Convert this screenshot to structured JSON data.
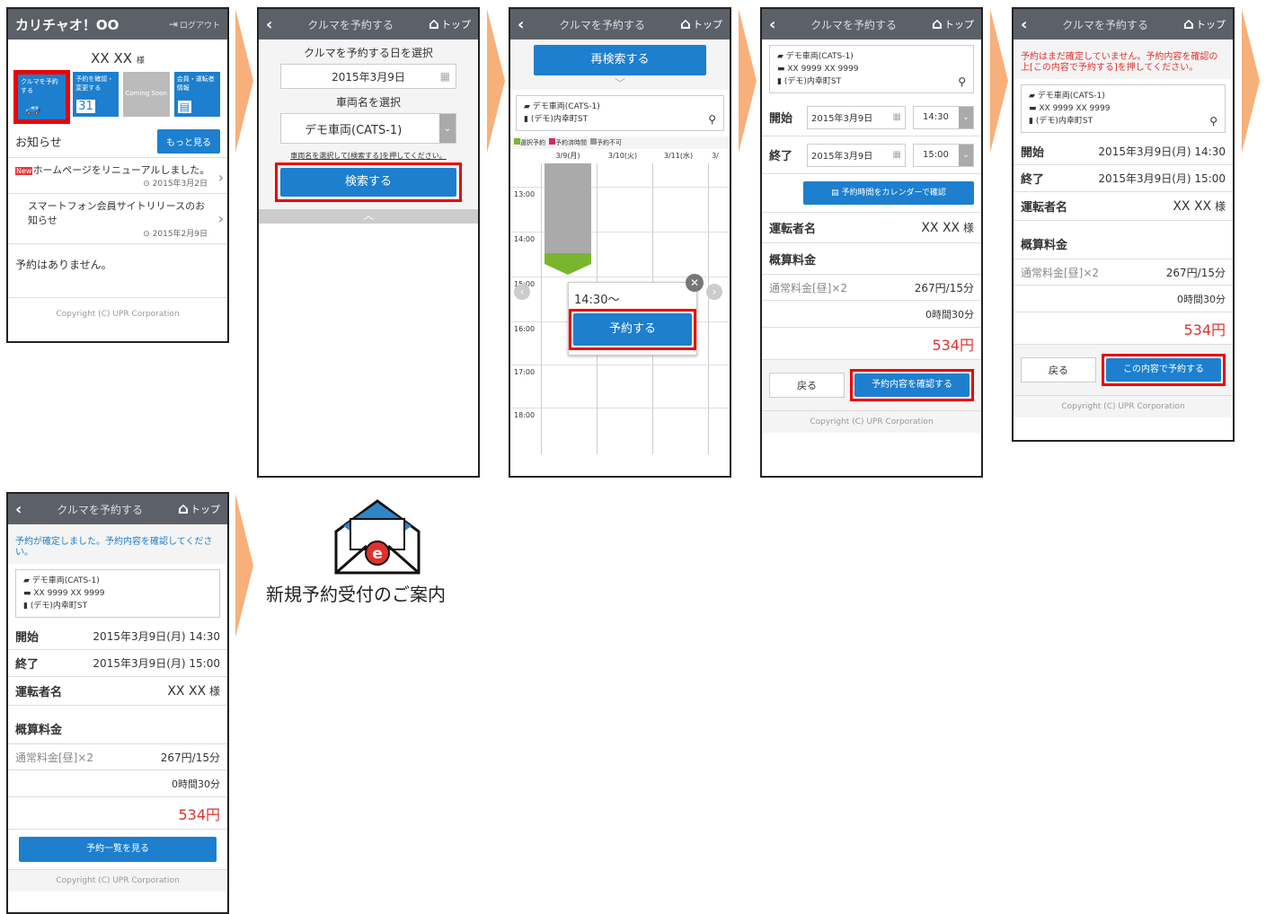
{
  "common": {
    "title": "クルマを予約する",
    "home": "トップ",
    "copyright": "Copyright (C) UPR Corporation",
    "vehicle": "デモ車両(CATS-1)",
    "plate": "XX 9999 XX 9999",
    "station": "(デモ)内幸町ST",
    "start_label": "開始",
    "end_label": "終了",
    "start_value": "2015年3月9日(月) 14:30",
    "end_value": "2015年3月9日(月) 15:00",
    "driver_label": "運転者名",
    "driver_name": "XX XX",
    "sama": "様",
    "fee_label": "概算料金",
    "fee_item": "通常料金[昼]×2",
    "fee_rate": "267円/15分",
    "fee_duration": "0時間30分",
    "fee_total": "534円",
    "back_btn": "戻る"
  },
  "screen1": {
    "app_title": "カリチャオ！OO",
    "logout": "ログアウト",
    "user": "XX XX",
    "sama": "様",
    "tiles": [
      {
        "label": "クルマを予約する",
        "icon": "car-icon"
      },
      {
        "label": "予約を確認・変更する",
        "icon": "calendar-icon"
      },
      {
        "label": "Coming Soon",
        "icon": "blank-icon"
      },
      {
        "label": "会員・運転者情報",
        "icon": "id-card-icon"
      }
    ],
    "news_label": "お知らせ",
    "more_btn": "もっと見る",
    "new_badge": "New",
    "news": [
      {
        "text": "ホームページをリニューアルしました。",
        "date": "2015年3月2日"
      },
      {
        "text": "スマートフォン会員サイトリリースのお知らせ",
        "date": "2015年2月9日"
      }
    ],
    "no_reservation": "予約はありません。"
  },
  "screen2": {
    "date_label": "クルマを予約する日を選択",
    "date_value": "2015年3月9日",
    "car_label": "車両名を選択",
    "car_value": "デモ車両(CATS-1)",
    "hint": "車両名を選択して[検索する]を押してください。",
    "search_btn": "検索する"
  },
  "screen3": {
    "research_btn": "再検索する",
    "legend": [
      "選択予約",
      "予約済時間",
      "予約不可"
    ],
    "days": [
      "3/9(月)",
      "3/10(火)",
      "3/11(水)",
      "3/"
    ],
    "hours": [
      "13:00",
      "14:00",
      "15:00",
      "16:00",
      "17:00",
      "18:00"
    ],
    "popup_time": "14:30〜",
    "reserve_btn": "予約する"
  },
  "screen4": {
    "start_date": "2015年3月9日",
    "start_time": "14:30",
    "end_date": "2015年3月9日",
    "end_time": "15:00",
    "calendar_btn": "予約時間をカレンダーで確認",
    "confirm_btn": "予約内容を確認する"
  },
  "screen5": {
    "warning": "予約はまだ確定していません。予約内容を確認の上[この内容で予約する]を押してください。",
    "book_btn": "この内容で予約する"
  },
  "screen6": {
    "message": "予約が確定しました。予約内容を確認してください。",
    "list_btn": "予約一覧を見る"
  },
  "email": {
    "caption": "新規予約受付のご案内"
  }
}
